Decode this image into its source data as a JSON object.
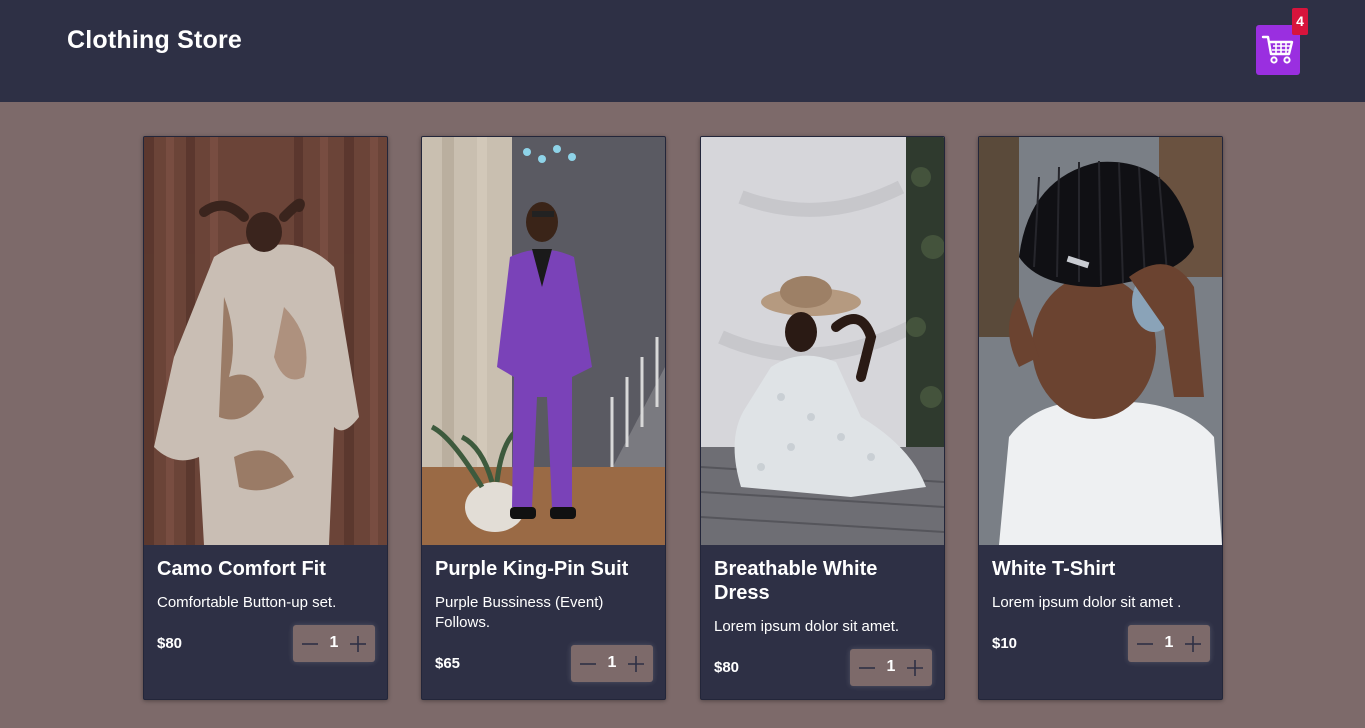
{
  "header": {
    "title": "Clothing Store",
    "cart_count": "4",
    "cart_icon": "shopping-cart-icon",
    "cart_color": "#9a2fe0",
    "badge_color": "#d7143c"
  },
  "products": [
    {
      "name": "Camo Comfort Fit",
      "description": "Comfortable Button-up set.",
      "price": "$80",
      "quantity": "1"
    },
    {
      "name": "Purple King-Pin Suit",
      "description": "Purple Bussiness (Event) Follows.",
      "price": "$65",
      "quantity": "1"
    },
    {
      "name": "Breathable White Dress",
      "description": "Lorem ipsum dolor sit amet.",
      "price": "$80",
      "quantity": "1"
    },
    {
      "name": "White T-Shirt",
      "description": "Lorem ipsum dolor sit amet .",
      "price": "$10",
      "quantity": "1"
    }
  ],
  "colors": {
    "header_bg": "#2e3045",
    "page_bg": "#7d6a6a",
    "card_bg": "#2e3045"
  }
}
